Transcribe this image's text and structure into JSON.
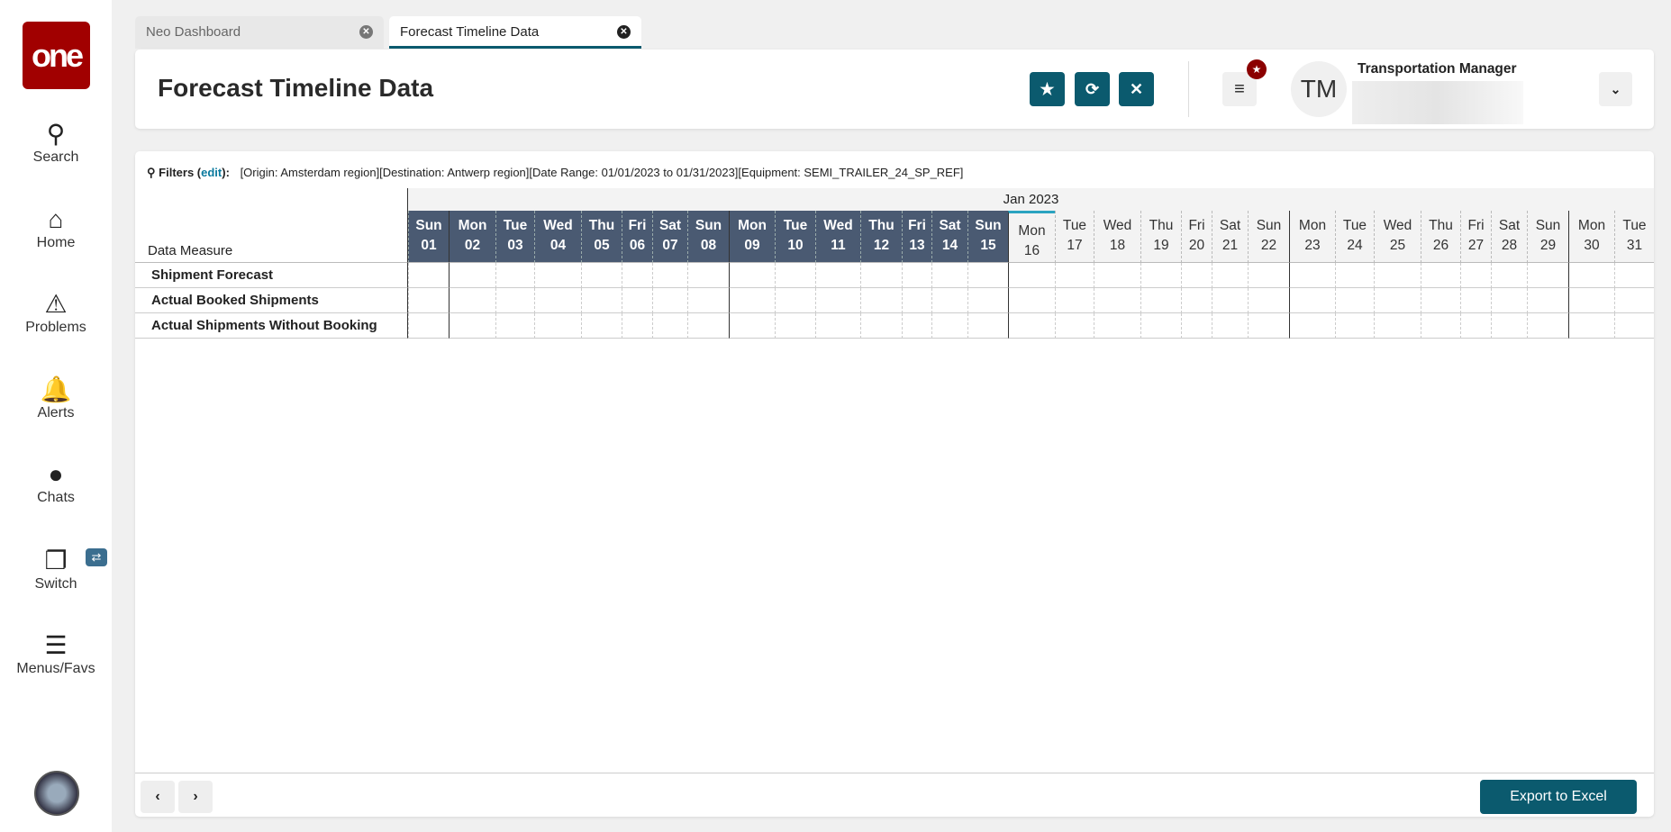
{
  "sidebar": {
    "logo": "one",
    "items": [
      {
        "label": "Search",
        "icon": "search-icon"
      },
      {
        "label": "Home",
        "icon": "home-icon"
      },
      {
        "label": "Problems",
        "icon": "warning-icon"
      },
      {
        "label": "Alerts",
        "icon": "bell-icon"
      },
      {
        "label": "Chats",
        "icon": "chat-icon"
      },
      {
        "label": "Switch",
        "icon": "switch-icon"
      },
      {
        "label": "Menus/Favs",
        "icon": "menu-icon"
      }
    ]
  },
  "tabs": [
    {
      "label": "Neo Dashboard",
      "active": false
    },
    {
      "label": "Forecast Timeline Data",
      "active": true
    }
  ],
  "header": {
    "title": "Forecast Timeline Data",
    "user_initials": "TM",
    "user_role": "Transportation Manager"
  },
  "filters": {
    "label": "Filters",
    "edit": "edit",
    "text": "[Origin: Amsterdam region][Destination: Antwerp region][Date Range: 01/01/2023 to 01/31/2023][Equipment: SEMI_TRAILER_24_SP_REF]"
  },
  "table": {
    "month": "Jan 2023",
    "measure_header": "Data Measure",
    "days": [
      [
        "Sun",
        "01"
      ],
      [
        "Mon",
        "02"
      ],
      [
        "Tue",
        "03"
      ],
      [
        "Wed",
        "04"
      ],
      [
        "Thu",
        "05"
      ],
      [
        "Fri",
        "06"
      ],
      [
        "Sat",
        "07"
      ],
      [
        "Sun",
        "08"
      ],
      [
        "Mon",
        "09"
      ],
      [
        "Tue",
        "10"
      ],
      [
        "Wed",
        "11"
      ],
      [
        "Thu",
        "12"
      ],
      [
        "Fri",
        "13"
      ],
      [
        "Sat",
        "14"
      ],
      [
        "Sun",
        "15"
      ],
      [
        "Mon",
        "16"
      ],
      [
        "Tue",
        "17"
      ],
      [
        "Wed",
        "18"
      ],
      [
        "Thu",
        "19"
      ],
      [
        "Fri",
        "20"
      ],
      [
        "Sat",
        "21"
      ],
      [
        "Sun",
        "22"
      ],
      [
        "Mon",
        "23"
      ],
      [
        "Tue",
        "24"
      ],
      [
        "Wed",
        "25"
      ],
      [
        "Thu",
        "26"
      ],
      [
        "Fri",
        "27"
      ],
      [
        "Sat",
        "28"
      ],
      [
        "Sun",
        "29"
      ],
      [
        "Mon",
        "30"
      ],
      [
        "Tue",
        "31"
      ]
    ],
    "today": "16",
    "rows": [
      "Shipment Forecast",
      "Actual Booked Shipments",
      "Actual Shipments Without Booking"
    ]
  },
  "footer": {
    "export": "Export to Excel"
  },
  "colors": {
    "accent": "#0b5a6e",
    "highlight": "#4a5a72",
    "brand": "#a10000"
  }
}
